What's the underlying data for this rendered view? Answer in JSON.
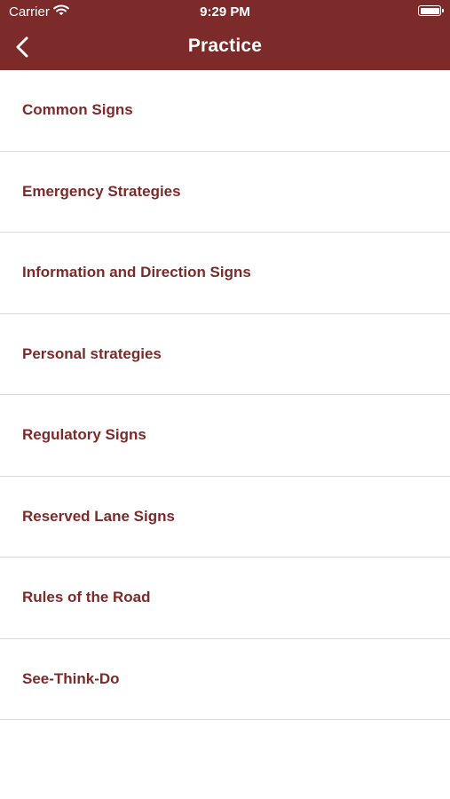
{
  "status_bar": {
    "carrier": "Carrier",
    "time": "9:29 PM",
    "wifi_icon": "wifi-icon",
    "battery_icon": "battery-icon"
  },
  "nav": {
    "title": "Practice",
    "back_icon": "chevron-left-icon"
  },
  "colors": {
    "brand": "#7d2a2a",
    "divider": "#d9d9d9",
    "background": "#ffffff"
  },
  "items": [
    {
      "label": "Common Signs"
    },
    {
      "label": "Emergency Strategies"
    },
    {
      "label": "Information and Direction Signs"
    },
    {
      "label": "Personal strategies"
    },
    {
      "label": "Regulatory Signs"
    },
    {
      "label": "Reserved Lane Signs"
    },
    {
      "label": "Rules of the Road"
    },
    {
      "label": "See-Think-Do"
    }
  ]
}
